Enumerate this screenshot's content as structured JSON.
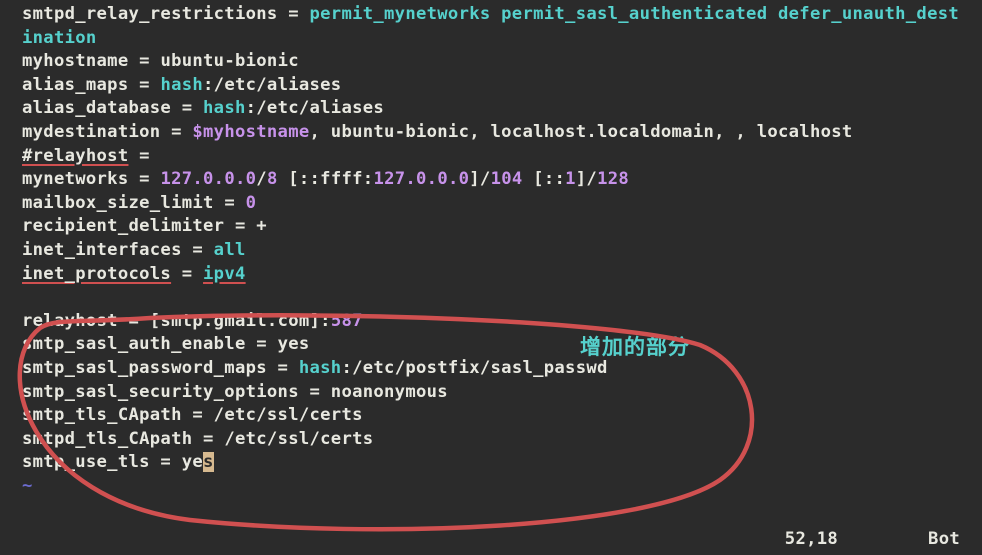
{
  "lines": {
    "l1_key": "smtpd_relay_restrictions",
    "l1_val": "permit_mynetworks permit_sasl_authenticated defer_unauth_destination",
    "l2_key": "myhostname",
    "l2_val": "ubuntu-bionic",
    "l3_key": "alias_maps",
    "l3_val": "hash",
    "l3_path": ":/etc/aliases",
    "l4_key": "alias_database",
    "l4_val": "hash",
    "l4_path": ":/etc/aliases",
    "l5_key": "mydestination",
    "l5_var": "$myhostname",
    "l5_rest": ", ubuntu-bionic, localhost.localdomain, , localhost",
    "l6_key": "#relayhost",
    "l7_key": "mynetworks",
    "l7_a": "127.0.0.0",
    "l7_b": "/",
    "l7_c": "8",
    "l7_d": " [::ffff:",
    "l7_e": "127.0.0.0",
    "l7_f": "]/",
    "l7_g": "104",
    "l7_h": " [::",
    "l7_i": "1",
    "l7_j": "]/",
    "l7_k": "128",
    "l8_key": "mailbox_size_limit",
    "l8_val": "0",
    "l9_key": "recipient_delimiter",
    "l9_val": "+",
    "l10_key": "inet_interfaces",
    "l10_val": "all",
    "l11_key": "inet_protocols",
    "l11_val": "ipv4",
    "l12": "",
    "l13_key": "relayhost",
    "l13_a": " [smtp",
    "l13_b": ".gmail.com",
    "l13_c": "]:",
    "l13_d": "587",
    "l14_key": "smtp_sasl_auth_enable",
    "l14_val": "yes",
    "l15_key": "smtp_sasl_password_maps",
    "l15_val": "hash",
    "l15_path": ":/etc/postfix/sasl_passwd",
    "l16_key": "smtp_sasl_security_options",
    "l16_val": "noanonymous",
    "l17_key": "smtp_tls_CApath",
    "l17_val": "/etc/ssl/certs",
    "l18_key": "smtpd_tls_CApath",
    "l18_val": "/etc/ssl/certs",
    "l19_key": "smtp_use_tls",
    "l19_a": "ye",
    "l19_b": "s",
    "tilde": "~"
  },
  "annotation": "增加的部分",
  "status": {
    "pos": "52,18",
    "mode": "Bot"
  },
  "eq": " = "
}
